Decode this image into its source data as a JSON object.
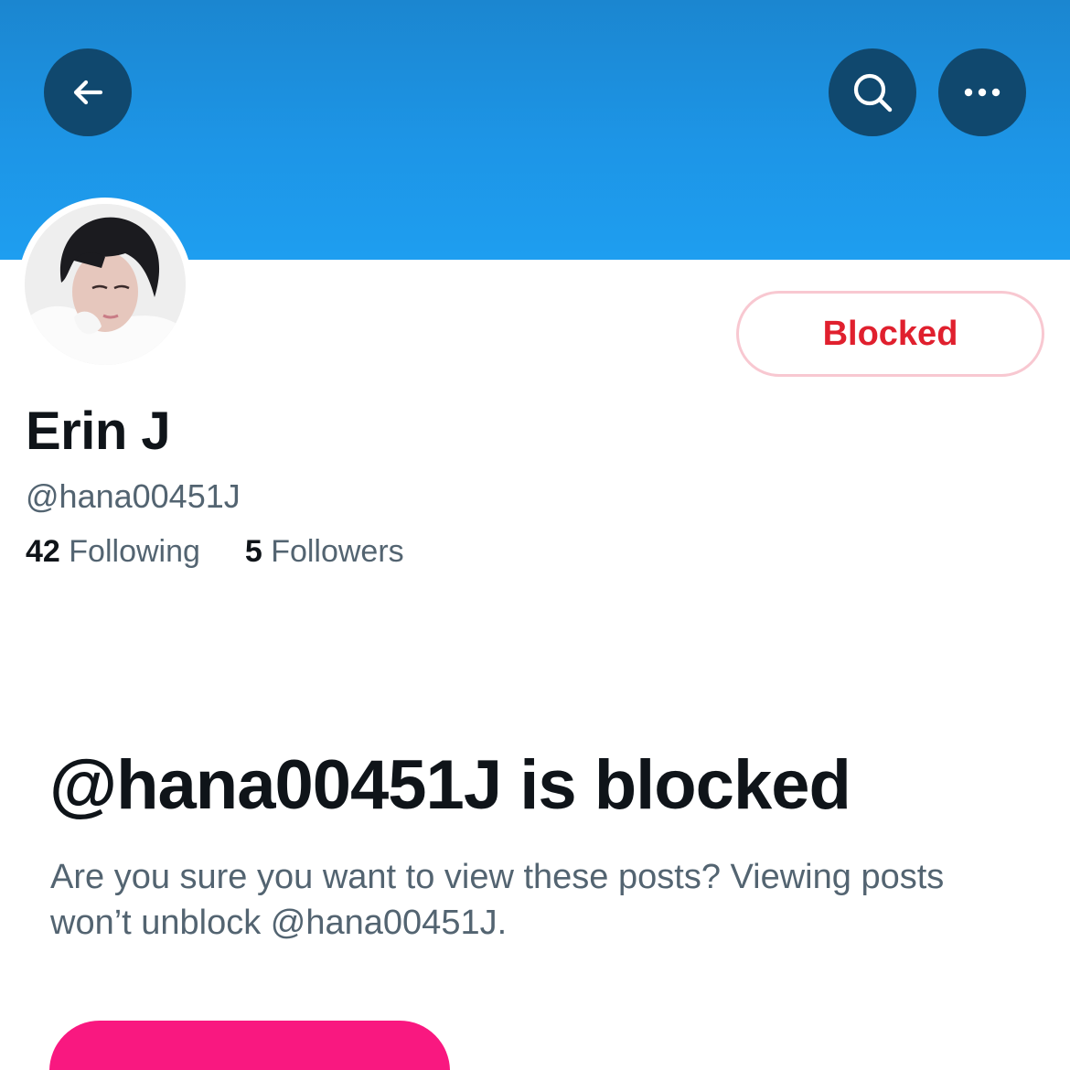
{
  "header": {
    "back_icon": "arrow-left-icon",
    "search_icon": "search-icon",
    "more_icon": "more-horizontal-icon",
    "banner_color": "#1d95e6",
    "button_color": "#10486e"
  },
  "profile": {
    "display_name": "Erin J",
    "handle": "@hana00451J",
    "following_count": "42",
    "following_label": "Following",
    "followers_count": "5",
    "followers_label": "Followers",
    "blocked_button_label": "Blocked",
    "blocked_button_color": "#e0202e"
  },
  "blocked_notice": {
    "title": "@hana00451J is blocked",
    "description": "Are you sure you want to view these posts? Viewing posts won’t unblock @hana00451J.",
    "action_button_color": "#f91880"
  }
}
